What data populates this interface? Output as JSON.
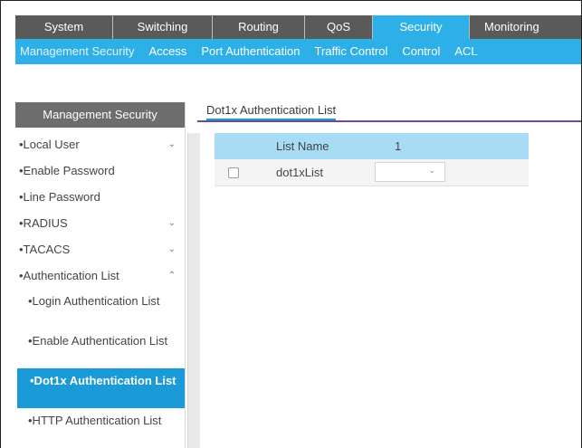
{
  "top_nav": {
    "tabs": [
      {
        "label": "System",
        "active": false
      },
      {
        "label": "Switching",
        "active": false
      },
      {
        "label": "Routing",
        "active": false
      },
      {
        "label": "QoS",
        "active": false
      },
      {
        "label": "Security",
        "active": true
      },
      {
        "label": "Monitoring",
        "active": false
      }
    ]
  },
  "sub_nav": {
    "items": [
      "Management Security",
      "Access",
      "Port Authentication",
      "Traffic Control",
      "Control",
      "ACL"
    ]
  },
  "sidebar": {
    "header": "Management Security",
    "items": [
      {
        "label": "•Local User",
        "chevron": "⌄"
      },
      {
        "label": "•Enable Password"
      },
      {
        "label": "•Line Password"
      },
      {
        "label": "•RADIUS",
        "chevron": "⌄"
      },
      {
        "label": "•TACACS",
        "chevron": "⌄"
      },
      {
        "label": "•Authentication List",
        "chevron": "⌃"
      }
    ],
    "sub_items": [
      "•Login Authentication List",
      "•Enable Authentication List",
      "•Dot1x Authentication List",
      "•HTTP Authentication List"
    ]
  },
  "main": {
    "title": "Dot1x Authentication List",
    "table": {
      "headers": [
        "",
        "List Name",
        "1"
      ],
      "rows": [
        {
          "checked": false,
          "name": "dot1xList",
          "value": ""
        }
      ]
    }
  },
  "colors": {
    "accent": "#2db0e8",
    "nav_bg": "#5a5a5a",
    "active_item": "#1a9ad6",
    "title_underline": "#6e4a91"
  }
}
